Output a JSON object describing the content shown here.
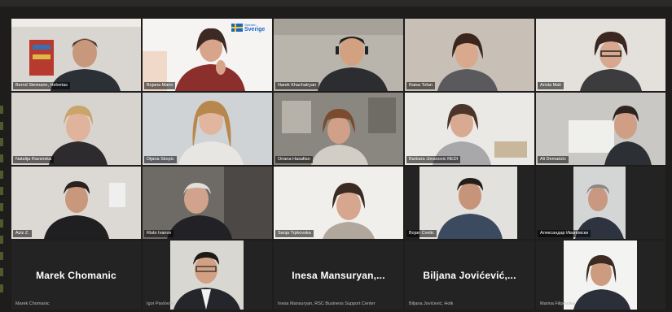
{
  "participants": [
    {
      "name": "Bernd Steimann, Helvetas"
    },
    {
      "name": "Bojana Marin"
    },
    {
      "name": "Narek Khachatryan"
    },
    {
      "name": "Raisa Tofan"
    },
    {
      "name": "Ariola Mali"
    },
    {
      "name": "Natalija Ravsirska"
    },
    {
      "name": "Dijana Skopic"
    },
    {
      "name": "Oriana Hasafian"
    },
    {
      "name": "Barbara Jovanovic REDI"
    },
    {
      "name": "Ali Demadzic"
    },
    {
      "name": "Aziz Z."
    },
    {
      "name": "Risto Ivanov"
    },
    {
      "name": "Sanja Trpkovska"
    },
    {
      "name": "Bojan Cvetic"
    },
    {
      "name": "Александар Ивановски"
    },
    {
      "name": "Marek Chomanic",
      "display": "Marek Chomanic"
    },
    {
      "name": "Igor Pavlovski"
    },
    {
      "name": "Inesa Mansuryan, RSC Business Support Center",
      "display": "Inesa  Mansuryan,..."
    },
    {
      "name": "Biljana Jovićević, Holk",
      "display": "Biljana  Jovićević,..."
    },
    {
      "name": "Marina Filipovska"
    }
  ],
  "logo": {
    "line1": "Sweden",
    "line2": "Sverige"
  },
  "colors": {
    "background": "#1e1d1c",
    "nametag_bg": "rgba(0,0,0,0.55)"
  }
}
